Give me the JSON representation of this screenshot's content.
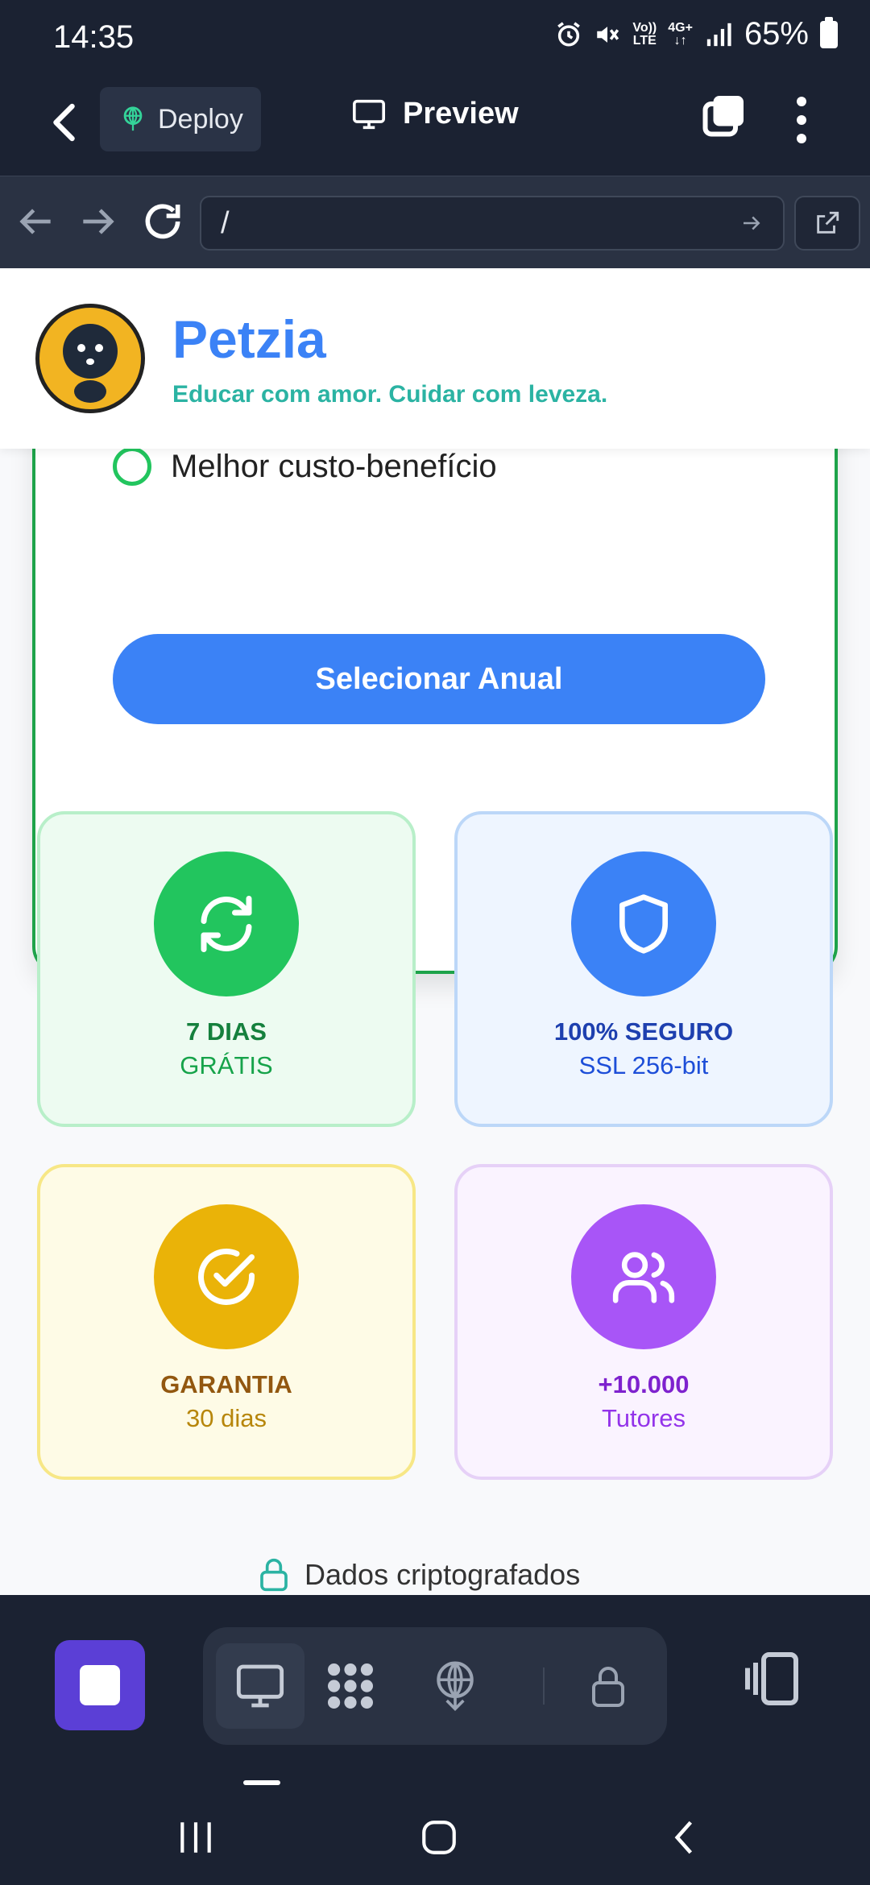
{
  "status": {
    "time": "14:35",
    "network_top": "Vo))",
    "network_bottom": "LTE",
    "net_gen": "4G+",
    "battery": "65%"
  },
  "appbar": {
    "deploy_label": "Deploy",
    "preview_label": "Preview"
  },
  "browser": {
    "url": "/"
  },
  "site": {
    "name": "Petzia",
    "tagline": "Educar com amor. Cuidar com leveza."
  },
  "plan": {
    "partial_feature": "Melhor custo-benefício",
    "select_button": "Selecionar Anual"
  },
  "badges": [
    {
      "title": "7 DIAS",
      "subtitle": "GRÁTIS",
      "icon": "refresh-icon",
      "accent": "#22c55e"
    },
    {
      "title": "100% SEGURO",
      "subtitle": "SSL 256-bit",
      "icon": "shield-icon",
      "accent": "#3b82f6"
    },
    {
      "title": "GARANTIA",
      "subtitle": "30 dias",
      "icon": "check-circle-icon",
      "accent": "#eab308"
    },
    {
      "title": "+10.000",
      "subtitle": "Tutores",
      "icon": "users-icon",
      "accent": "#a855f7"
    }
  ],
  "footer_note": "Dados criptografados",
  "colors": {
    "brand": "#3b82f6",
    "tagline": "#2bb3a3",
    "stop_button": "#5b3fd6"
  }
}
